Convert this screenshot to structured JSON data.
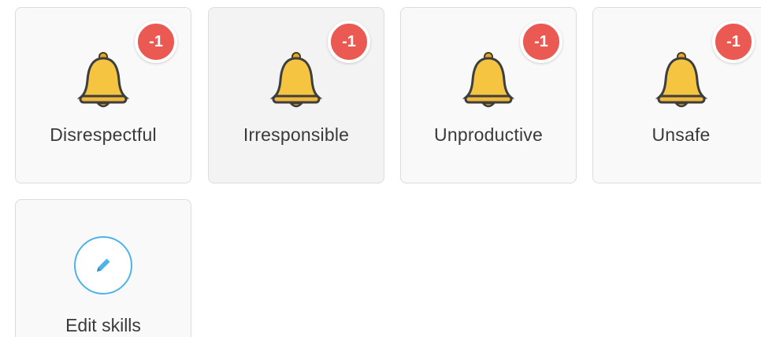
{
  "skills": [
    {
      "label": "Disrespectful",
      "points": "-1",
      "icon": "bell-icon"
    },
    {
      "label": "Irresponsible",
      "points": "-1",
      "icon": "bell-icon"
    },
    {
      "label": "Unproductive",
      "points": "-1",
      "icon": "bell-icon"
    },
    {
      "label": "Unsafe",
      "points": "-1",
      "icon": "bell-icon"
    }
  ],
  "edit": {
    "label": "Edit skills",
    "icon": "pencil-icon"
  },
  "colors": {
    "badge": "#ea5a52",
    "bell": "#f5c542",
    "edit_accent": "#4db3ea"
  }
}
